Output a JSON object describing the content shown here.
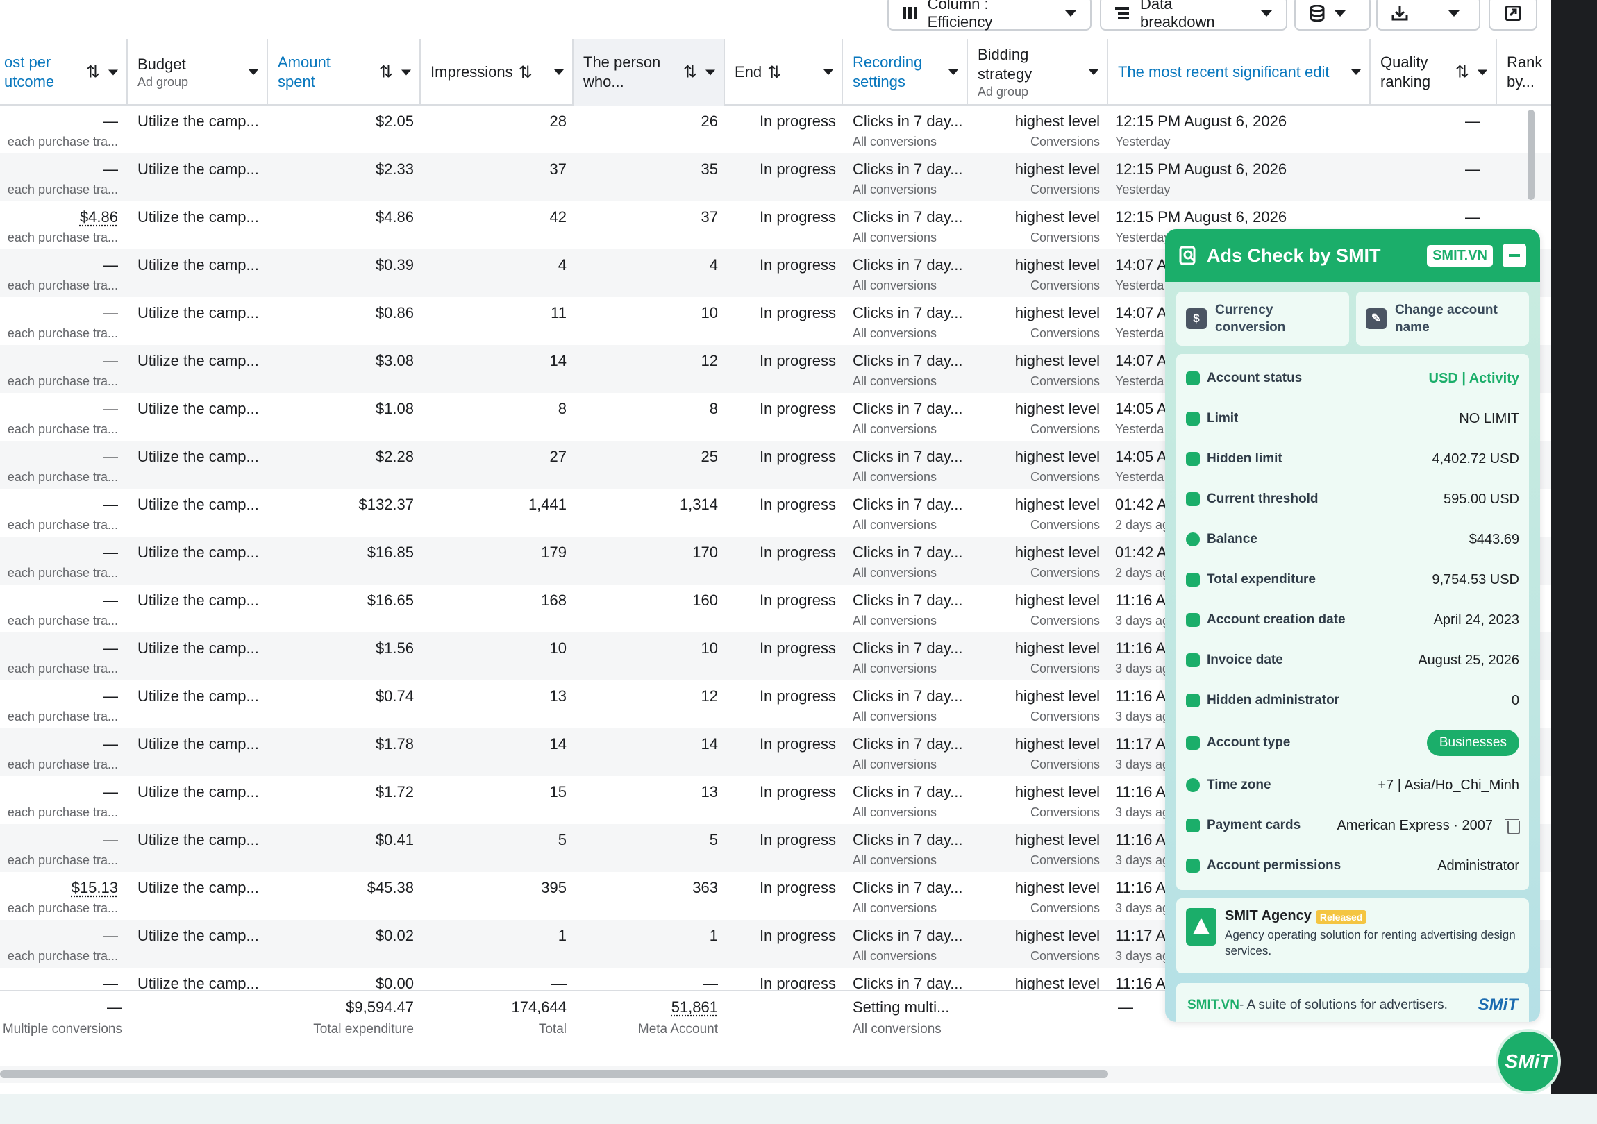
{
  "toolbar": {
    "columns_label": "Column : Efficiency",
    "breakdown_label": "Data breakdown"
  },
  "columns": {
    "cost": "ost per\nutcome",
    "budget": "Budget",
    "budget_sub": "Ad group",
    "amount": "Amount spent",
    "impressions": "Impressions",
    "reach": "The person who...",
    "end": "End",
    "recording": "Recording settings",
    "bidding": "Bidding strategy",
    "bidding_sub": "Ad group",
    "recent_edit": "The most recent significant edit",
    "quality": "Quality ranking",
    "rank": "Rank by..."
  },
  "rows": [
    {
      "cost": "—",
      "cost_sub": "each purchase tra...",
      "budget": "Utilize the camp...",
      "amount": "$2.05",
      "impressions": "28",
      "reach": "26",
      "end": "In progress",
      "rec": "Clicks in 7 day...",
      "rec_sub": "All conversions",
      "bid": "highest level",
      "bid_sub": "Conversions",
      "edit": "12:15 PM August 6, 2026",
      "edit_sub": "Yesterday",
      "quality": "—"
    },
    {
      "cost": "—",
      "cost_sub": "each purchase tra...",
      "budget": "Utilize the camp...",
      "amount": "$2.33",
      "impressions": "37",
      "reach": "35",
      "end": "In progress",
      "rec": "Clicks in 7 day...",
      "rec_sub": "All conversions",
      "bid": "highest level",
      "bid_sub": "Conversions",
      "edit": "12:15 PM August 6, 2026",
      "edit_sub": "Yesterday",
      "quality": "—"
    },
    {
      "cost": "$4.86",
      "cost_sub": "each purchase tra...",
      "budget": "Utilize the camp...",
      "amount": "$4.86",
      "impressions": "42",
      "reach": "37",
      "end": "In progress",
      "rec": "Clicks in 7 day...",
      "rec_sub": "All conversions",
      "bid": "highest level",
      "bid_sub": "Conversions",
      "edit": "12:15 PM August 6, 2026",
      "edit_sub": "Yesterday",
      "quality": "—"
    },
    {
      "cost": "—",
      "cost_sub": "each purchase tra...",
      "budget": "Utilize the camp...",
      "amount": "$0.39",
      "impressions": "4",
      "reach": "4",
      "end": "In progress",
      "rec": "Clicks in 7 day...",
      "rec_sub": "All conversions",
      "bid": "highest level",
      "bid_sub": "Conversions",
      "edit": "14:07 A",
      "edit_sub": "Yesterda",
      "quality": ""
    },
    {
      "cost": "—",
      "cost_sub": "each purchase tra...",
      "budget": "Utilize the camp...",
      "amount": "$0.86",
      "impressions": "11",
      "reach": "10",
      "end": "In progress",
      "rec": "Clicks in 7 day...",
      "rec_sub": "All conversions",
      "bid": "highest level",
      "bid_sub": "Conversions",
      "edit": "14:07 A",
      "edit_sub": "Yesterda",
      "quality": ""
    },
    {
      "cost": "—",
      "cost_sub": "each purchase tra...",
      "budget": "Utilize the camp...",
      "amount": "$3.08",
      "impressions": "14",
      "reach": "12",
      "end": "In progress",
      "rec": "Clicks in 7 day...",
      "rec_sub": "All conversions",
      "bid": "highest level",
      "bid_sub": "Conversions",
      "edit": "14:07 A",
      "edit_sub": "Yesterda",
      "quality": ""
    },
    {
      "cost": "—",
      "cost_sub": "each purchase tra...",
      "budget": "Utilize the camp...",
      "amount": "$1.08",
      "impressions": "8",
      "reach": "8",
      "end": "In progress",
      "rec": "Clicks in 7 day...",
      "rec_sub": "All conversions",
      "bid": "highest level",
      "bid_sub": "Conversions",
      "edit": "14:05 A",
      "edit_sub": "Yesterda",
      "quality": ""
    },
    {
      "cost": "—",
      "cost_sub": "each purchase tra...",
      "budget": "Utilize the camp...",
      "amount": "$2.28",
      "impressions": "27",
      "reach": "25",
      "end": "In progress",
      "rec": "Clicks in 7 day...",
      "rec_sub": "All conversions",
      "bid": "highest level",
      "bid_sub": "Conversions",
      "edit": "14:05 A",
      "edit_sub": "Yesterda",
      "quality": ""
    },
    {
      "cost": "—",
      "cost_sub": "each purchase tra...",
      "budget": "Utilize the camp...",
      "amount": "$132.37",
      "impressions": "1,441",
      "reach": "1,314",
      "end": "In progress",
      "rec": "Clicks in 7 day...",
      "rec_sub": "All conversions",
      "bid": "highest level",
      "bid_sub": "Conversions",
      "edit": "01:42 A",
      "edit_sub": "2 days ag",
      "quality": ""
    },
    {
      "cost": "—",
      "cost_sub": "each purchase tra...",
      "budget": "Utilize the camp...",
      "amount": "$16.85",
      "impressions": "179",
      "reach": "170",
      "end": "In progress",
      "rec": "Clicks in 7 day...",
      "rec_sub": "All conversions",
      "bid": "highest level",
      "bid_sub": "Conversions",
      "edit": "01:42 A",
      "edit_sub": "2 days ag",
      "quality": ""
    },
    {
      "cost": "—",
      "cost_sub": "each purchase tra...",
      "budget": "Utilize the camp...",
      "amount": "$16.65",
      "impressions": "168",
      "reach": "160",
      "end": "In progress",
      "rec": "Clicks in 7 day...",
      "rec_sub": "All conversions",
      "bid": "highest level",
      "bid_sub": "Conversions",
      "edit": "11:16 AI",
      "edit_sub": "3 days ag",
      "quality": ""
    },
    {
      "cost": "—",
      "cost_sub": "each purchase tra...",
      "budget": "Utilize the camp...",
      "amount": "$1.56",
      "impressions": "10",
      "reach": "10",
      "end": "In progress",
      "rec": "Clicks in 7 day...",
      "rec_sub": "All conversions",
      "bid": "highest level",
      "bid_sub": "Conversions",
      "edit": "11:16 AI",
      "edit_sub": "3 days ag",
      "quality": ""
    },
    {
      "cost": "—",
      "cost_sub": "each purchase tra...",
      "budget": "Utilize the camp...",
      "amount": "$0.74",
      "impressions": "13",
      "reach": "12",
      "end": "In progress",
      "rec": "Clicks in 7 day...",
      "rec_sub": "All conversions",
      "bid": "highest level",
      "bid_sub": "Conversions",
      "edit": "11:16 AI",
      "edit_sub": "3 days ag",
      "quality": ""
    },
    {
      "cost": "—",
      "cost_sub": "each purchase tra...",
      "budget": "Utilize the camp...",
      "amount": "$1.78",
      "impressions": "14",
      "reach": "14",
      "end": "In progress",
      "rec": "Clicks in 7 day...",
      "rec_sub": "All conversions",
      "bid": "highest level",
      "bid_sub": "Conversions",
      "edit": "11:17 Au",
      "edit_sub": "3 days ag",
      "quality": ""
    },
    {
      "cost": "—",
      "cost_sub": "each purchase tra...",
      "budget": "Utilize the camp...",
      "amount": "$1.72",
      "impressions": "15",
      "reach": "13",
      "end": "In progress",
      "rec": "Clicks in 7 day...",
      "rec_sub": "All conversions",
      "bid": "highest level",
      "bid_sub": "Conversions",
      "edit": "11:16 AI",
      "edit_sub": "3 days ag",
      "quality": ""
    },
    {
      "cost": "—",
      "cost_sub": "each purchase tra...",
      "budget": "Utilize the camp...",
      "amount": "$0.41",
      "impressions": "5",
      "reach": "5",
      "end": "In progress",
      "rec": "Clicks in 7 day...",
      "rec_sub": "All conversions",
      "bid": "highest level",
      "bid_sub": "Conversions",
      "edit": "11:16 AI",
      "edit_sub": "3 days ag",
      "quality": ""
    },
    {
      "cost": "$15.13",
      "cost_sub": "each purchase tra...",
      "budget": "Utilize the camp...",
      "amount": "$45.38",
      "impressions": "395",
      "reach": "363",
      "end": "In progress",
      "rec": "Clicks in 7 day...",
      "rec_sub": "All conversions",
      "bid": "highest level",
      "bid_sub": "Conversions",
      "edit": "11:16 AI",
      "edit_sub": "3 days ag",
      "quality": ""
    },
    {
      "cost": "—",
      "cost_sub": "each purchase tra...",
      "budget": "Utilize the camp...",
      "amount": "$0.02",
      "impressions": "1",
      "reach": "1",
      "end": "In progress",
      "rec": "Clicks in 7 day...",
      "rec_sub": "All conversions",
      "bid": "highest level",
      "bid_sub": "Conversions",
      "edit": "11:17 Au",
      "edit_sub": "3 days ag",
      "quality": ""
    },
    {
      "cost": "—",
      "cost_sub": "",
      "budget": "Utilize the camp...",
      "amount": "$0.00",
      "impressions": "—",
      "reach": "—",
      "end": "In progress",
      "rec": "Clicks in 7 day...",
      "rec_sub": "",
      "bid": "highest level",
      "bid_sub": "",
      "edit": "11:16 AI",
      "edit_sub": "",
      "quality": ""
    }
  ],
  "totals": {
    "cost": "—",
    "cost_sub": "Multiple conversions",
    "amount": "$9,594.47",
    "amount_sub": "Total expenditure",
    "impressions": "174,644",
    "impressions_sub": "Total",
    "reach": "51,861",
    "reach_sub": "Meta Account",
    "rec": "Setting multi...",
    "rec_sub": "All conversions",
    "edit": "—"
  },
  "panel": {
    "title": "Ads Check by SMIT",
    "tag": "SMIT.VN",
    "tool_currency": "Currency conversion",
    "tool_rename": "Change account name",
    "items": [
      {
        "key": "Account status",
        "value": "USD | Activity"
      },
      {
        "key": "Limit",
        "value": "NO LIMIT"
      },
      {
        "key": "Hidden limit",
        "value": "4,402.72 USD"
      },
      {
        "key": "Current threshold",
        "value": "595.00 USD"
      },
      {
        "key": "Balance",
        "value": "$443.69"
      },
      {
        "key": "Total expenditure",
        "value": "9,754.53 USD"
      },
      {
        "key": "Account creation date",
        "value": "April 24, 2023"
      },
      {
        "key": "Invoice date",
        "value": "August 25, 2026"
      },
      {
        "key": "Hidden administrator",
        "value": "0"
      },
      {
        "key": "Account type",
        "value": "Businesses"
      },
      {
        "key": "Time zone",
        "value": "+7 | Asia/Ho_Chi_Minh"
      },
      {
        "key": "Payment cards",
        "value": "American Express · 2007"
      },
      {
        "key": "Account permissions",
        "value": "Administrator"
      }
    ],
    "agency_title": "SMIT Agency",
    "agency_badge": "Released",
    "agency_desc": "Agency operating solution for renting advertising design services.",
    "footer_brand": "SMIT.VN",
    "footer_text": " - A suite of solutions for advertisers.",
    "footer_logo": "SMiT",
    "fab_label": "SMiT"
  },
  "colors": {
    "accent": "#1bae6a",
    "link": "#0a78be"
  }
}
